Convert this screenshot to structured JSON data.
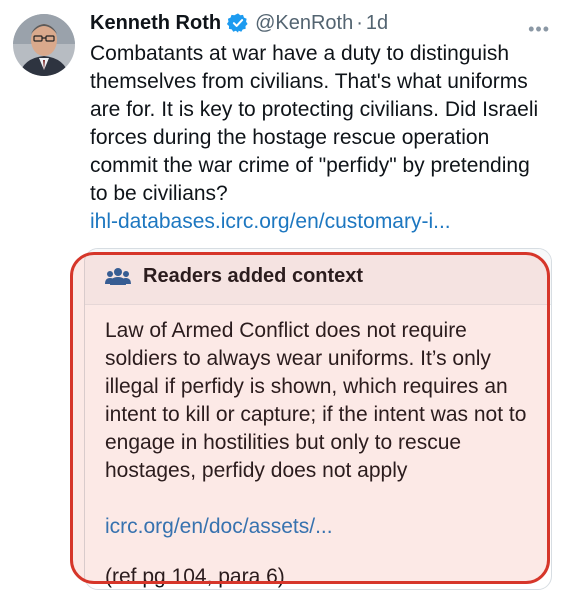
{
  "tweet": {
    "author_name": "Kenneth Roth",
    "handle": "@KenRoth",
    "separator": "·",
    "time": "1d",
    "verified_icon": "verified-badge-icon",
    "more_icon": "more-horizontal-icon",
    "text": "Combatants at war have a duty to distinguish themselves from civilians. That's what uniforms are for. It is key to protecting civilians. Did Israeli forces during the hostage rescue operation commit the war crime of \"perfidy\" by pretending to be civilians?",
    "link": "ihl-databases.icrc.org/en/customary-i..."
  },
  "community_note": {
    "icon": "people-icon",
    "header": "Readers added context",
    "text": "Law of Armed Conflict does not require soldiers to always wear uniforms. It’s only illegal if perfidy is shown, which requires an intent to kill or capture; if the intent was not to engage in hostilities but only to rescue hostages, perfidy does not apply",
    "link": "icrc.org/en/doc/assets/...",
    "reference": "(ref pg 104, para 6)"
  },
  "colors": {
    "link": "#1d77c0",
    "verified": "#1d9bf0",
    "highlight_border": "#d6362a",
    "highlight_fill": "#e8543e",
    "text": "#0f1419",
    "secondary_text": "#536471"
  }
}
